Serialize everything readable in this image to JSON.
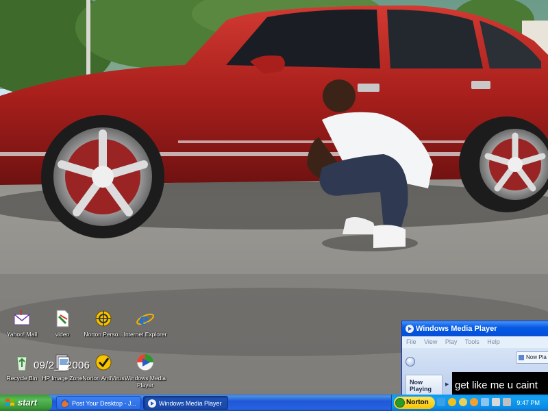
{
  "desktop": {
    "date_stamp": "09/2__2006",
    "icons": [
      {
        "label": "Yahoo! Mail",
        "icon": "yahoo-mail-icon"
      },
      {
        "label": "video",
        "icon": "video-file-icon"
      },
      {
        "label": "Norton Perso...",
        "icon": "norton-personal-firewall-icon"
      },
      {
        "label": "Internet Explorer",
        "icon": "internet-explorer-icon"
      },
      {
        "label": "Recycle Bin",
        "icon": "recycle-bin-icon"
      },
      {
        "label": "HP Image Zone",
        "icon": "hp-image-zone-icon"
      },
      {
        "label": "Norton AntiVirus",
        "icon": "norton-antivirus-icon"
      },
      {
        "label": "Windows Media Player",
        "icon": "windows-media-player-icon"
      }
    ]
  },
  "wmp": {
    "title": "Windows Media Player",
    "menu": [
      "File",
      "View",
      "Play",
      "Tools",
      "Help"
    ],
    "now_playing_tab": "Now Pla",
    "now_playing_side": "Now Playing",
    "video_caption": "get like me u caint"
  },
  "taskbar": {
    "start_label": "start",
    "tasks": [
      {
        "label": "Post Your Desktop - J...",
        "icon": "firefox-icon"
      },
      {
        "label": "Windows Media Player",
        "icon": "windows-media-player-icon"
      }
    ],
    "tray": {
      "norton_label": "Norton",
      "clock": "9:47 PM"
    }
  },
  "colors": {
    "xp_blue": "#2663e0",
    "start_green": "#3c993b",
    "tray_blue": "#0b8ce5",
    "norton_yellow": "#f7c400"
  }
}
